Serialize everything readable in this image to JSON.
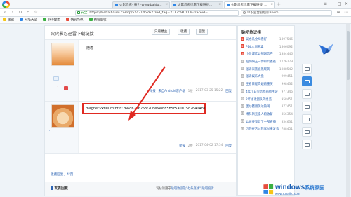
{
  "browser": {
    "tabs": [
      {
        "label": "火影忍者- 搜力-www.baidu...",
        "active": false
      },
      {
        "label": "火影忍者迅雷下载链接...",
        "active": false
      },
      {
        "label": "火影忍者迅雷下载链接_...",
        "active": true
      }
    ],
    "url_secure_label": "安全",
    "url": "https://tieba.baidu.com/p/5242145762?red_tag=2137591003&traceid=",
    "search_text": "单职业合剧超影Boom"
  },
  "bookmarks": [
    {
      "label": "收藏",
      "color": "#f5c518"
    },
    {
      "label": "网址大全",
      "color": "#2f86e6"
    },
    {
      "label": "360搜索",
      "color": "#3cb043"
    },
    {
      "label": "快剪TVR",
      "color": "#e74c3c"
    },
    {
      "label": "获极值收",
      "color": "#3cb043"
    }
  ],
  "thread": {
    "title": "火火影忍迅雷下载链接",
    "buttons": {
      "only_lz": "只看楼主",
      "favorite": "收藏",
      "reply": "回复"
    }
  },
  "posts": [
    {
      "text": "随着",
      "level": "1",
      "tail": {
        "report": "举报",
        "device": "来自Android客户端",
        "floor": "1楼",
        "time": "2017-03-25 15:22",
        "reply": "回复"
      }
    },
    {
      "text": "magnet:?xt=urn:btih:266d6726253f20bef48b85b5c5a0075d2b404ce",
      "tail": {
        "report": "举报",
        "floor": "2楼",
        "time": "2017-04-02 17:54",
        "reply": "回复"
      }
    }
  ],
  "footer": {
    "favorite": "收藏回复，4ℓ页",
    "reply_title": "发表回复",
    "reply_links_prefix": "发帖请遵守",
    "reply_links_rule": "贴吧协议及\"七条底线\"",
    "reply_links_report": "贴吧投诉"
  },
  "sidebar": {
    "title": "贴吧热议榜",
    "items": [
      {
        "rank": "1",
        "text": "吴亦凡全网看好",
        "count": "1897546"
      },
      {
        "rank": "2",
        "text": "PDL人间五毒",
        "count": "1806092"
      },
      {
        "rank": "3",
        "text": "小贝爆炸公部网信产",
        "count": "1384446"
      },
      {
        "rank": "4",
        "text": "赵明研王一博和兵爸爸",
        "count": "1276279"
      },
      {
        "rank": "5",
        "text": "张译家族被黑暖黄",
        "count": "1088542"
      },
      {
        "rank": "6",
        "text": "张译娱乐大盘",
        "count": "999451"
      },
      {
        "rank": "7",
        "text": "王者日程白娘娘重奖",
        "count": "998432"
      },
      {
        "rank": "8",
        "text": "4年小白完结原画师手游",
        "count": "977346"
      },
      {
        "rank": "9",
        "text": "2年进攻团队的总监",
        "count": "958451"
      },
      {
        "rank": "10",
        "text": "蛋炒猪用美达热闹",
        "count": "877451"
      },
      {
        "rank": "11",
        "text": "博科斯克提人娘收薪",
        "count": "856354"
      },
      {
        "rank": "12",
        "text": "公司要我剪了一部直播",
        "count": "854631"
      },
      {
        "rank": "13",
        "text": "历的存活过我家扯事发丢",
        "count": "788451"
      }
    ]
  },
  "watermark": {
    "brand": "windows",
    "suffix": "系统家园",
    "url": "www.runaihu.com"
  },
  "colors": {
    "accent": "#2d64b3",
    "highlight": "#e02a22",
    "brand_blue": "#1a5fb4"
  }
}
